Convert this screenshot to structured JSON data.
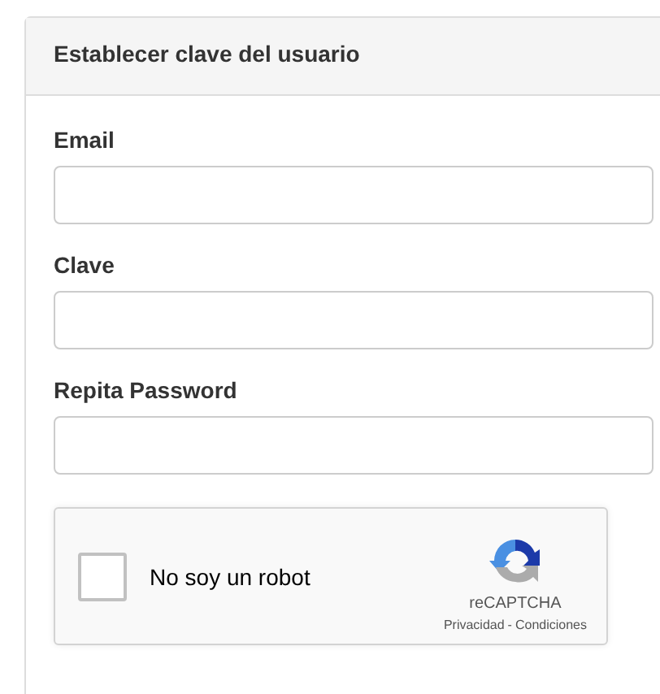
{
  "panel": {
    "title": "Establecer clave del usuario"
  },
  "fields": [
    {
      "label": "Email"
    },
    {
      "label": "Clave"
    },
    {
      "label": "Repita Password"
    }
  ],
  "captcha": {
    "label": "No soy un robot",
    "checked": false,
    "brand": "reCAPTCHA",
    "privacy": "Privacidad",
    "separator": "-",
    "terms": "Condiciones"
  }
}
